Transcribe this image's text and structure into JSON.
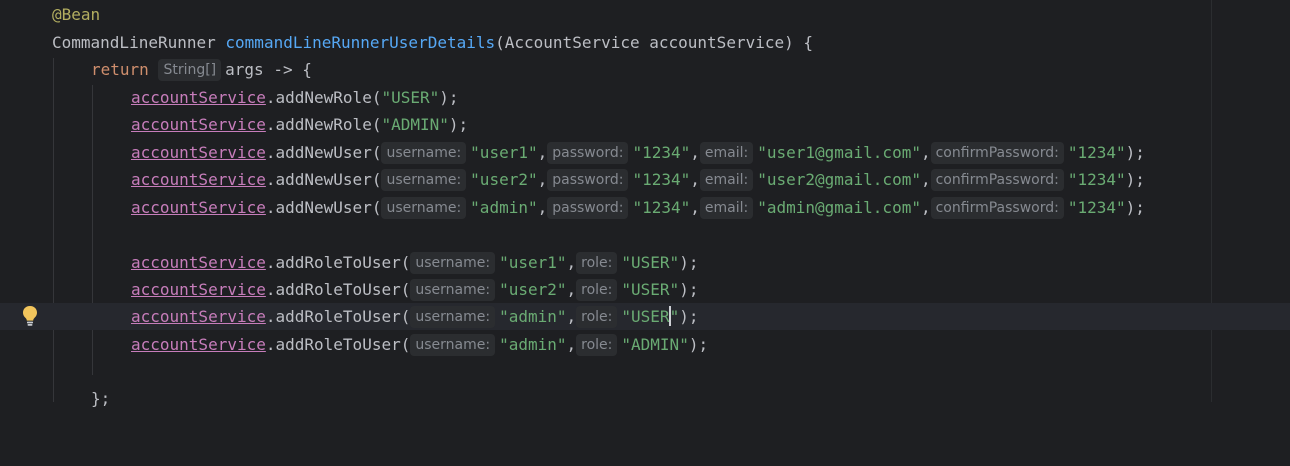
{
  "editor": {
    "lines": {
      "l1": {
        "annotation": "@Bean"
      },
      "l2": {
        "type": "CommandLineRunner",
        "method": "commandLineRunnerUserDetails",
        "params": "(AccountService accountService) {"
      },
      "l3": {
        "keyword": "return",
        "hint": "String[]",
        "rest": "args -> {"
      },
      "l4": {
        "field": "accountService",
        "call": ".addNewRole(",
        "arg": "\"USER\"",
        "end": ");"
      },
      "l5": {
        "field": "accountService",
        "call": ".addNewRole(",
        "arg": "\"ADMIN\"",
        "end": ");"
      },
      "l6": {
        "field": "accountService",
        "call": ".addNewUser(",
        "h1": "username:",
        "a1": "\"user1\"",
        "h2": "password:",
        "a2": "\"1234\"",
        "h3": "email:",
        "a3": "\"user1@gmail.com\"",
        "h4": "confirmPassword:",
        "a4": "\"1234\"",
        "end": ");"
      },
      "l7": {
        "field": "accountService",
        "call": ".addNewUser(",
        "h1": "username:",
        "a1": "\"user2\"",
        "h2": "password:",
        "a2": "\"1234\"",
        "h3": "email:",
        "a3": "\"user2@gmail.com\"",
        "h4": "confirmPassword:",
        "a4": "\"1234\"",
        "end": ");"
      },
      "l8": {
        "field": "accountService",
        "call": ".addNewUser(",
        "h1": "username:",
        "a1": "\"admin\"",
        "h2": "password:",
        "a2": "\"1234\"",
        "h3": "email:",
        "a3": "\"admin@gmail.com\"",
        "h4": "confirmPassword:",
        "a4": "\"1234\"",
        "end": ");"
      },
      "l10": {
        "field": "accountService",
        "call": ".addRoleToUser(",
        "h1": "username:",
        "a1": "\"user1\"",
        "h2": "role:",
        "a2": "\"USER\"",
        "end": ");"
      },
      "l11": {
        "field": "accountService",
        "call": ".addRoleToUser(",
        "h1": "username:",
        "a1": "\"user2\"",
        "h2": "role:",
        "a2": "\"USER\"",
        "end": ");"
      },
      "l12": {
        "field": "accountService",
        "call": ".addRoleToUser(",
        "h1": "username:",
        "a1": "\"admin\"",
        "h2": "role:",
        "a2_before_caret": "\"USER",
        "a2_after_caret": "\"",
        "end": ");"
      },
      "l13": {
        "field": "accountService",
        "call": ".addRoleToUser(",
        "h1": "username:",
        "a1": "\"admin\"",
        "h2": "role:",
        "a2": "\"ADMIN\"",
        "end": ");"
      },
      "l15": {
        "text": "};"
      }
    },
    "icons": {
      "intention": "lightbulb-icon"
    },
    "colors": {
      "background": "#1e1f22",
      "keyword": "#cf8e6d",
      "string": "#6aab73",
      "method": "#56a8f5",
      "field": "#c77dbb",
      "annotation": "#b3ae60"
    }
  }
}
